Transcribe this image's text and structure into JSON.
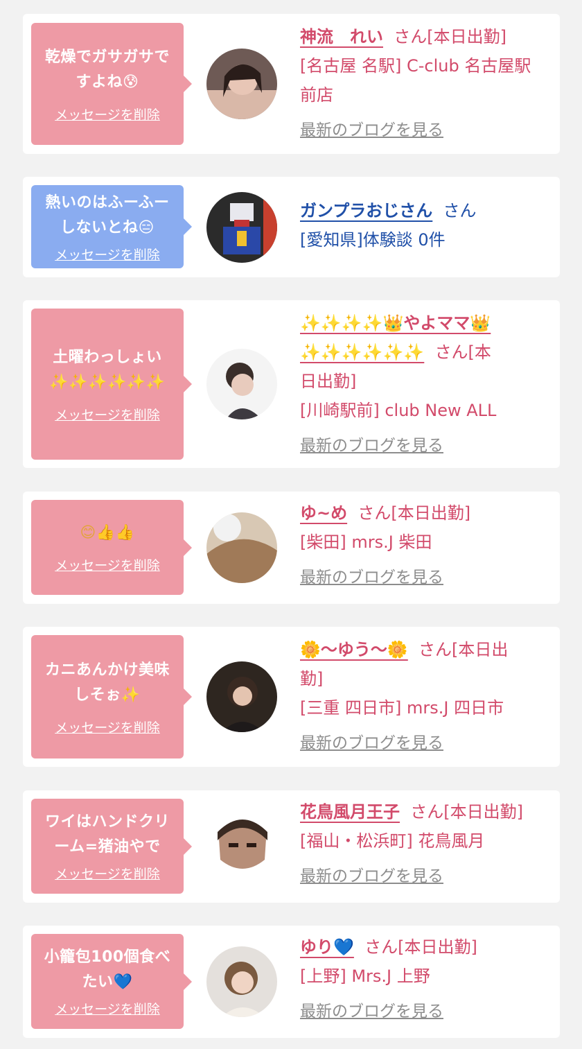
{
  "delete_label": "メッセージを削除",
  "blog_label": "最新のブログを見る",
  "cards": [
    {
      "msg_l1": "乾燥でガサガサで",
      "msg_l2": "すよね",
      "msg_emoji": "😰",
      "name": "神流　れい",
      "suffix": "さん[本日出勤]",
      "shop_l1": "[名古屋 名駅] C-club 名古屋駅",
      "shop_l2": "前店"
    },
    {
      "msg_l1": "熱いのはふーふー",
      "msg_l2": "しないとね",
      "msg_emoji": "😑",
      "name": "ガンプラおじさん",
      "suffix": "さん",
      "shop_l1": "[愛知県]体験談 0件"
    },
    {
      "msg_l1": "土曜わっしょい",
      "msg_emoji": "✨✨✨✨✨✨",
      "name_l1": "✨✨✨✨👑やよママ👑",
      "name_l2": "✨✨✨✨✨✨",
      "suffix_l1": "さん[本",
      "suffix_l2": "日出勤]",
      "shop_l1": "[川崎駅前] club New ALL"
    },
    {
      "msg_emoji": "😊👍👍",
      "name": "ゆ~め",
      "suffix": "さん[本日出勤]",
      "shop_l1": "[柴田] mrs.J 柴田"
    },
    {
      "msg_l1": "カニあんかけ美味",
      "msg_l2": "しそぉ",
      "msg_emoji": "✨",
      "name": "🌼〜ゆう〜🌼",
      "suffix_l1": "さん[本日出",
      "suffix_l2": "勤]",
      "shop_l1": "[三重 四日市] mrs.J 四日市"
    },
    {
      "msg_l1": "ワイはハンドクリ",
      "msg_l2": "ーム=猪油やで",
      "name": "花鳥風月王子",
      "suffix": "さん[本日出勤]",
      "shop_l1": "[福山・松浜町] 花鳥風月"
    },
    {
      "msg_l1": "小籠包100個食べ",
      "msg_l2": "たい",
      "msg_emoji": "💙",
      "name": "ゆり",
      "name_emoji": "💙",
      "suffix": "さん[本日出勤]",
      "shop_l1": "[上野] Mrs.J 上野"
    }
  ]
}
